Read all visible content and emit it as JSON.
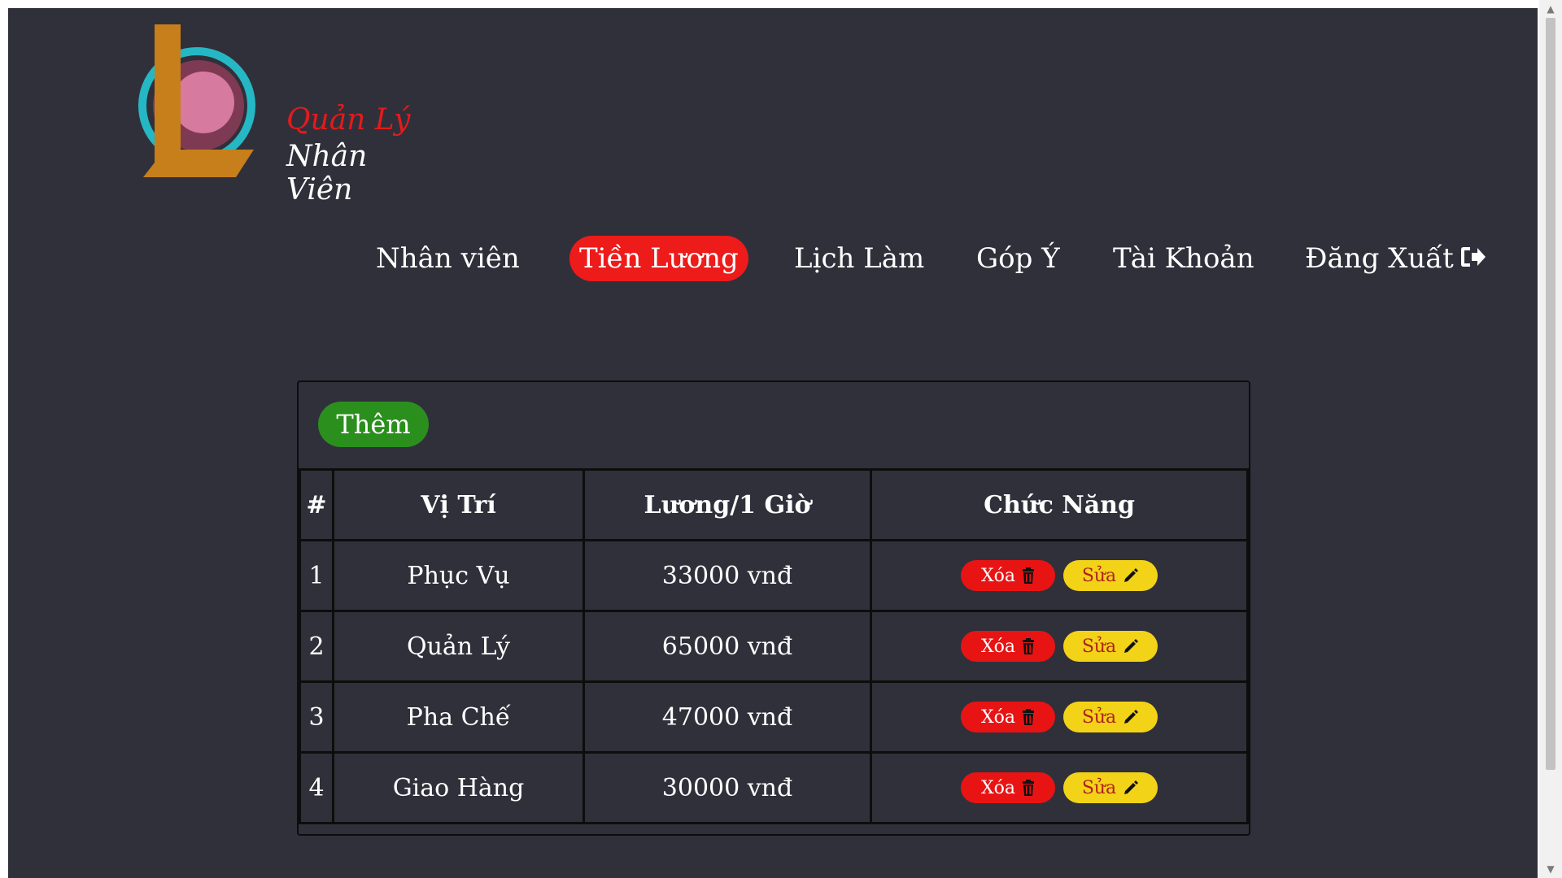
{
  "logo": {
    "line1": "Quản Lý",
    "line2": "Nhân Viên"
  },
  "nav": {
    "items": [
      {
        "label": "Nhân viên",
        "active": false
      },
      {
        "label": "Tiền Lương",
        "active": true
      },
      {
        "label": "Lịch Làm",
        "active": false
      },
      {
        "label": "Góp Ý",
        "active": false
      },
      {
        "label": "Tài Khoản",
        "active": false
      },
      {
        "label": "Đăng Xuất",
        "active": false,
        "icon": "logout-icon"
      }
    ]
  },
  "toolbar": {
    "add_label": "Thêm"
  },
  "table": {
    "headers": [
      "#",
      "Vị Trí",
      "Lương/1 Giờ",
      "Chức Năng"
    ],
    "rows": [
      {
        "index": "1",
        "position": "Phục Vụ",
        "salary": "33000 vnđ"
      },
      {
        "index": "2",
        "position": "Quản Lý",
        "salary": "65000 vnđ"
      },
      {
        "index": "3",
        "position": "Pha Chế",
        "salary": "47000 vnđ"
      },
      {
        "index": "4",
        "position": "Giao Hàng",
        "salary": "30000 vnđ"
      }
    ],
    "delete_label": "Xóa",
    "edit_label": "Sửa"
  },
  "colors": {
    "background": "#30303b",
    "active_nav": "#ee1b1b",
    "add_button": "#2b8f1e",
    "delete_button": "#e81414",
    "edit_button": "#f2d318"
  }
}
